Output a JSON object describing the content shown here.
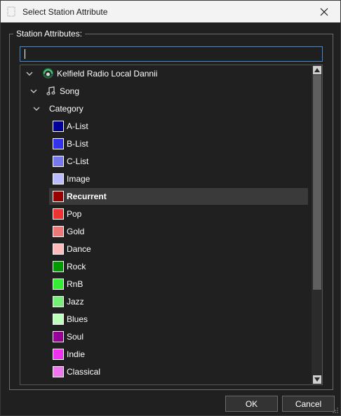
{
  "window": {
    "title": "Select Station Attribute",
    "close_icon": "close-icon"
  },
  "group": {
    "label": "Station Attributes:"
  },
  "search": {
    "value": "",
    "placeholder": ""
  },
  "tree": {
    "station": {
      "label": "Kelfield Radio Local Dannii",
      "icon": "station-icon"
    },
    "song": {
      "label": "Song",
      "icon": "music-note-icon"
    },
    "category": {
      "label": "Category"
    },
    "items": [
      {
        "label": "A-List",
        "color": "#000099"
      },
      {
        "label": "B-List",
        "color": "#3333ee"
      },
      {
        "label": "C-List",
        "color": "#7777ee"
      },
      {
        "label": "Image",
        "color": "#bbbbff"
      },
      {
        "label": "Recurrent",
        "color": "#990000",
        "selected": true
      },
      {
        "label": "Pop",
        "color": "#ee3333"
      },
      {
        "label": "Gold",
        "color": "#ee7777"
      },
      {
        "label": "Dance",
        "color": "#ffbbbb"
      },
      {
        "label": "Rock",
        "color": "#009900"
      },
      {
        "label": "RnB",
        "color": "#33ee33"
      },
      {
        "label": "Jazz",
        "color": "#77ee77"
      },
      {
        "label": "Blues",
        "color": "#bbffbb"
      },
      {
        "label": "Soul",
        "color": "#990099"
      },
      {
        "label": "Indie",
        "color": "#ee33ee"
      },
      {
        "label": "Classical",
        "color": "#ee77ee"
      }
    ]
  },
  "buttons": {
    "ok": "OK",
    "cancel": "Cancel"
  },
  "colors": {
    "background": "#202020",
    "titlebar": "#f3f3f3",
    "focus_border": "#3d8bd9",
    "selection": "#3a3a3a"
  }
}
